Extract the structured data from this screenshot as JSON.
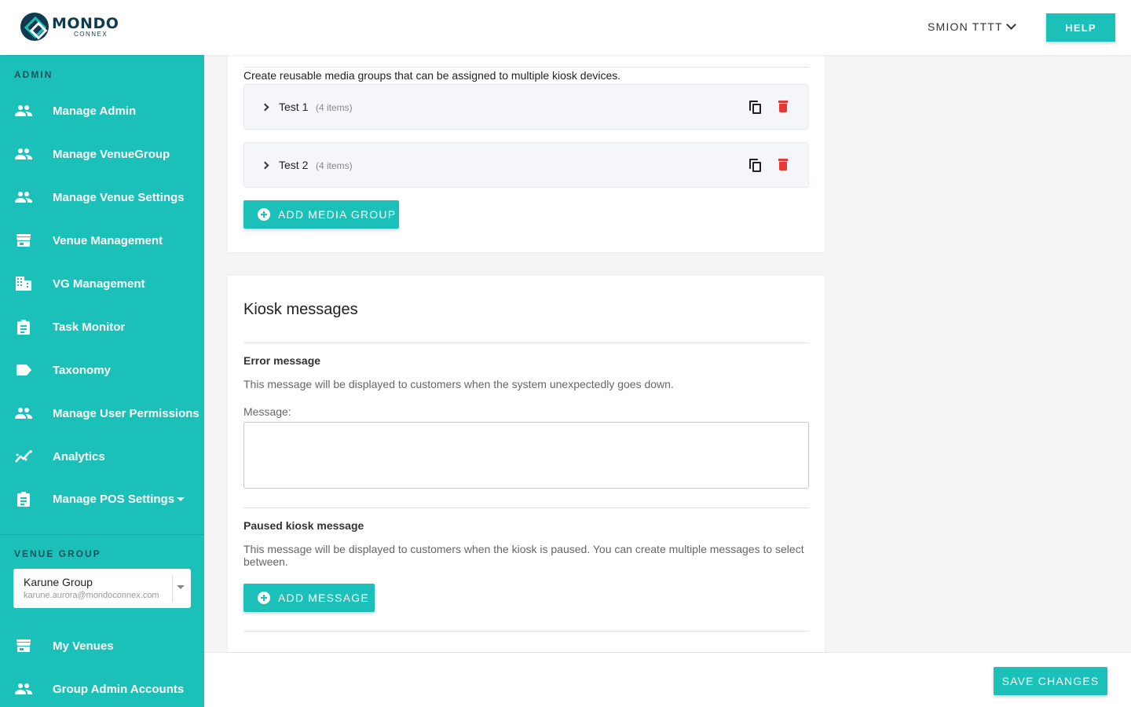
{
  "header": {
    "logo_title": "MONDO",
    "logo_sub": "CONNEX",
    "user_name": "SMION TTTT",
    "help_label": "HELP"
  },
  "sidebar": {
    "admin_label": "ADMIN",
    "items": [
      {
        "label": "Manage Admin",
        "icon": "people-icon"
      },
      {
        "label": "Manage VenueGroup",
        "icon": "people-icon"
      },
      {
        "label": "Manage Venue Settings",
        "icon": "people-icon"
      },
      {
        "label": "Venue Management",
        "icon": "store-icon"
      },
      {
        "label": "VG Management",
        "icon": "building-icon"
      },
      {
        "label": "Task Monitor",
        "icon": "clipboard-icon"
      },
      {
        "label": "Taxonomy",
        "icon": "tag-icon"
      },
      {
        "label": "Manage User Permissions",
        "icon": "people-icon"
      },
      {
        "label": "Analytics",
        "icon": "analytics-icon"
      },
      {
        "label": "Manage POS Settings",
        "icon": "clipboard-icon"
      }
    ],
    "venue_group_label": "VENUE GROUP",
    "venue_group": {
      "name": "Karune Group",
      "email": "karune.aurora@mondoconnex.com"
    },
    "bottom_items": [
      {
        "label": "My Venues",
        "icon": "store-icon"
      },
      {
        "label": "Group Admin Accounts",
        "icon": "people-icon"
      }
    ]
  },
  "media_groups": {
    "description": "Create reusable media groups that can be assigned to multiple kiosk devices.",
    "items": [
      {
        "title": "Test 1",
        "count": "(4 items)"
      },
      {
        "title": "Test 2",
        "count": "(4 items)"
      }
    ],
    "add_label": "ADD MEDIA GROUP"
  },
  "kiosk_messages": {
    "title": "Kiosk messages",
    "error_title": "Error message",
    "error_help": "This message will be displayed to customers when the system unexpectedly goes down.",
    "message_label": "Message:",
    "message_value": "",
    "paused_title": "Paused kiosk message",
    "paused_help": "This message will be displayed to customers when the kiosk is paused. You can create multiple messages to select between.",
    "add_message_label": "ADD MESSAGE"
  },
  "footer": {
    "save_label": "SAVE CHANGES"
  },
  "colors": {
    "accent": "#1bc1b9",
    "brand_dark": "#0f3a4f",
    "danger": "#e53935"
  }
}
